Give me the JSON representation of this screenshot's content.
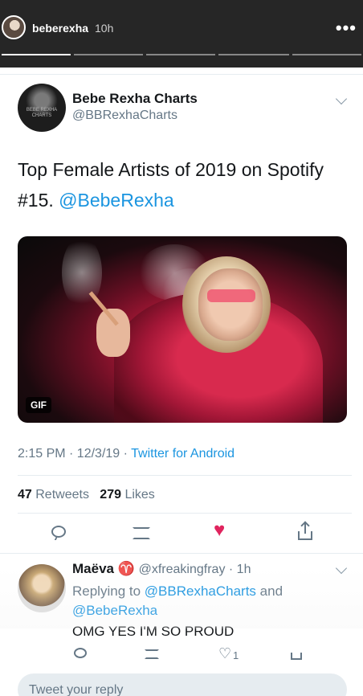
{
  "story": {
    "username": "beberexha",
    "time": "10h",
    "more_icon": "more-dots-icon"
  },
  "tweet": {
    "display_name": "Bebe Rexha Charts",
    "handle": "@BBRexhaCharts",
    "avatar_text": "BEBE REXHA CHARTS",
    "text_line1": "Top Female Artists of 2019 on Spotify",
    "text_line2_prefix": "#15.",
    "text_mention": "@BebeRexha",
    "media_badge": "GIF",
    "time": "2:15 PM · 12/3/19 · ",
    "source": "Twitter for Android",
    "retweets_count": "47",
    "retweets_label": "Retweets",
    "likes_count": "279",
    "likes_label": "Likes"
  },
  "reply": {
    "display_name": "Maëva ♈",
    "handle": "@xfreakingfray · 1h",
    "replying_prefix": "Replying to ",
    "replying_to_1": "@BBRexhaCharts",
    "replying_and": " and",
    "replying_to_2": "@BebeRexha",
    "text": "OMG YES I'M SO PROUD",
    "like_count": "1"
  },
  "compose": {
    "placeholder": "Tweet your reply"
  },
  "colors": {
    "accent": "#1b95e0",
    "like": "#e0245e",
    "muted": "#657786"
  }
}
